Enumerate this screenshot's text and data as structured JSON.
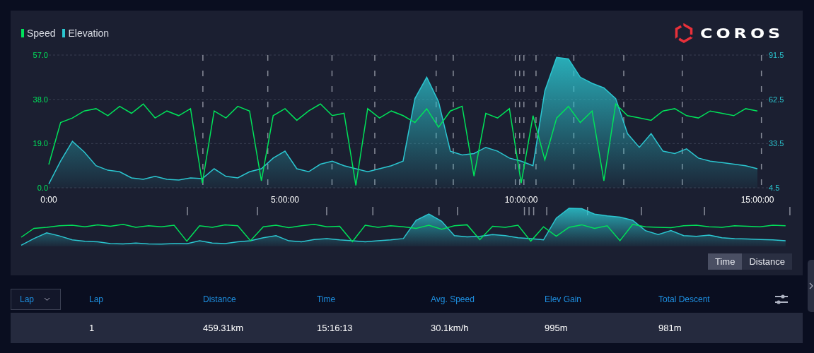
{
  "logo": {
    "text": "COROS"
  },
  "chart_data": {
    "type": "line",
    "grid": true,
    "xlim": [
      0,
      15.1
    ],
    "ylim": [
      0,
      57
    ],
    "yticks": [
      {
        "value": 0,
        "label": "0.0"
      },
      {
        "value": 19,
        "label": "19.0"
      },
      {
        "value": 38,
        "label": "38.0"
      },
      {
        "value": 57,
        "label": "57.0"
      }
    ],
    "y2lim": [
      4.5,
      91.5
    ],
    "y2ticks": [
      {
        "value": 4.5,
        "label": "4.5"
      },
      {
        "value": 33.5,
        "label": "33.5"
      },
      {
        "value": 62.5,
        "label": "62.5"
      },
      {
        "value": 91.5,
        "label": "91.5"
      }
    ],
    "xticks": [
      {
        "value": 0,
        "label": "0:00"
      },
      {
        "value": 5,
        "label": "5:00:00"
      },
      {
        "value": 10,
        "label": "10:00:00"
      },
      {
        "value": 15,
        "label": "15:00:00"
      }
    ],
    "x": [
      0,
      0.25,
      0.5,
      0.75,
      1,
      1.25,
      1.5,
      1.75,
      2,
      2.25,
      2.5,
      2.75,
      3,
      3.25,
      3.5,
      3.75,
      4,
      4.25,
      4.5,
      4.75,
      5,
      5.25,
      5.5,
      5.75,
      6,
      6.25,
      6.5,
      6.75,
      7,
      7.25,
      7.5,
      7.75,
      8,
      8.25,
      8.5,
      8.75,
      9,
      9.25,
      9.5,
      9.75,
      10,
      10.25,
      10.5,
      10.75,
      11,
      11.25,
      11.5,
      11.75,
      12,
      12.25,
      12.5,
      12.75,
      13,
      13.25,
      13.5,
      13.75,
      14,
      14.25,
      14.5,
      14.75,
      15
    ],
    "series": [
      {
        "name": "Speed",
        "color": "#00e25a",
        "values": [
          10,
          28,
          30,
          33,
          34,
          31,
          35,
          32,
          36,
          30,
          33,
          31,
          34,
          2,
          33,
          30,
          35,
          33,
          3,
          31,
          34,
          29,
          33,
          36,
          31,
          32,
          1,
          34,
          30,
          33,
          31,
          28,
          34,
          26,
          33,
          35,
          5,
          32,
          30,
          34,
          2,
          31,
          12,
          30,
          35,
          28,
          33,
          3,
          36,
          31,
          30,
          29,
          33,
          34,
          31,
          30,
          33,
          32,
          31,
          34,
          33
        ]
      },
      {
        "name": "Elevation",
        "color": "#2bc6d0",
        "axis": "y2",
        "type": "area",
        "values": [
          7,
          22,
          35,
          28,
          19,
          16,
          15,
          11,
          10,
          12,
          10,
          9.6,
          11,
          10.5,
          17,
          12,
          11,
          15,
          17,
          24,
          28.5,
          17,
          15,
          20,
          22,
          19,
          17,
          15,
          17,
          19,
          22,
          63,
          77,
          61,
          28.5,
          26,
          27,
          31,
          28.5,
          24,
          22,
          19,
          68,
          90,
          89,
          77,
          73,
          70,
          63,
          40,
          31,
          40,
          28.5,
          27,
          30,
          24,
          22,
          21,
          20,
          19,
          17
        ]
      }
    ]
  },
  "axis_modes": [
    {
      "label": "Time",
      "selected": true
    },
    {
      "label": "Distance",
      "selected": false
    }
  ],
  "lap_selector": {
    "value": "Lap"
  },
  "table": {
    "columns": [
      "Lap",
      "Distance",
      "Time",
      "Avg. Speed",
      "Elev Gain",
      "Total Descent"
    ],
    "rows": [
      [
        "1",
        "459.31km",
        "15:16:13",
        "30.1km/h",
        "995m",
        "981m"
      ]
    ]
  }
}
